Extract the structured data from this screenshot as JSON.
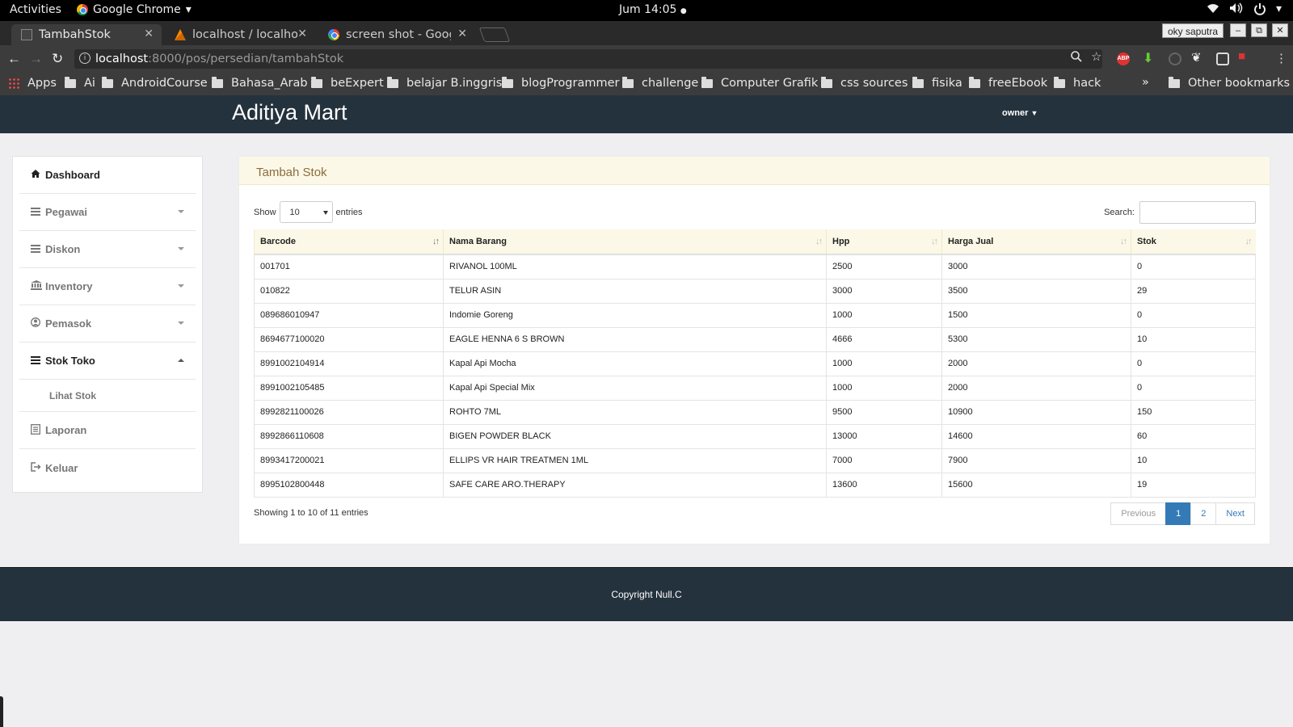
{
  "system_bar": {
    "activities": "Activities",
    "app_name": "Google Chrome",
    "clock": "Jum 14:05"
  },
  "browser": {
    "tabs": [
      {
        "title": "TambahStok",
        "favicon": "page-icon",
        "active": true
      },
      {
        "title": "localhost / localhos",
        "favicon": "phpmyadmin-icon",
        "active": false
      },
      {
        "title": "screen shot - Googl",
        "favicon": "google-icon",
        "active": false
      }
    ],
    "profile_name": "oky saputra",
    "url_host": "localhost",
    "url_rest": ":8000/pos/persedian/tambahStok",
    "bookmarks": [
      {
        "label": "Apps",
        "icon": "apps-grid-icon"
      },
      {
        "label": "Ai",
        "icon": "folder-icon"
      },
      {
        "label": "AndroidCourse",
        "icon": "folder-icon"
      },
      {
        "label": "Bahasa_Arab",
        "icon": "folder-icon"
      },
      {
        "label": "beExpert",
        "icon": "folder-icon"
      },
      {
        "label": "belajar B.inggris",
        "icon": "folder-icon"
      },
      {
        "label": "blogProgrammer",
        "icon": "folder-icon"
      },
      {
        "label": "challenge",
        "icon": "folder-icon"
      },
      {
        "label": "Computer Grafik",
        "icon": "folder-icon"
      },
      {
        "label": "css sources",
        "icon": "folder-icon"
      },
      {
        "label": "fisika",
        "icon": "folder-icon"
      },
      {
        "label": "freeEbook",
        "icon": "folder-icon"
      },
      {
        "label": "hack",
        "icon": "folder-icon"
      }
    ],
    "overflow": "»",
    "other_bookmarks": "Other bookmarks"
  },
  "header": {
    "brand": "Aditiya Mart",
    "user_menu": "owner"
  },
  "sidebar": {
    "items": [
      {
        "label": "Dashboard",
        "icon": "home-icon"
      },
      {
        "label": "Pegawai",
        "icon": "list-icon"
      },
      {
        "label": "Diskon",
        "icon": "list-icon"
      },
      {
        "label": "Inventory",
        "icon": "bank-icon"
      },
      {
        "label": "Pemasok",
        "icon": "user-circle-icon"
      },
      {
        "label": "Stok Toko",
        "icon": "list-icon"
      },
      {
        "label": "Lihat Stok",
        "icon": ""
      },
      {
        "label": "Laporan",
        "icon": "report-icon"
      },
      {
        "label": "Keluar",
        "icon": "sign-out-icon"
      }
    ]
  },
  "main": {
    "panel_title": "Tambah Stok",
    "show_label": "Show",
    "page_length": "10",
    "entries_label": "entries",
    "search_label": "Search:",
    "search_value": "",
    "columns": [
      "Barcode",
      "Nama Barang",
      "Hpp",
      "Harga Jual",
      "Stok"
    ],
    "rows": [
      [
        "001701",
        "RIVANOL 100ML",
        "2500",
        "3000",
        "0"
      ],
      [
        "010822",
        "TELUR ASIN",
        "3000",
        "3500",
        "29"
      ],
      [
        "089686010947",
        "Indomie Goreng",
        "1000",
        "1500",
        "0"
      ],
      [
        "8694677100020",
        "EAGLE HENNA 6 S BROWN",
        "4666",
        "5300",
        "10"
      ],
      [
        "8991002104914",
        "Kapal Api Mocha",
        "1000",
        "2000",
        "0"
      ],
      [
        "8991002105485",
        "Kapal Api Special Mix",
        "1000",
        "2000",
        "0"
      ],
      [
        "8992821100026",
        "ROHTO 7ML",
        "9500",
        "10900",
        "150"
      ],
      [
        "8992866110608",
        "BIGEN POWDER BLACK",
        "13000",
        "14600",
        "60"
      ],
      [
        "8993417200021",
        "ELLIPS VR HAIR TREATMEN 1ML",
        "7000",
        "7900",
        "10"
      ],
      [
        "8995102800448",
        "SAFE CARE ARO.THERAPY",
        "13600",
        "15600",
        "19"
      ]
    ],
    "info": "Showing 1 to 10 of 11 entries",
    "pagination": {
      "previous": "Previous",
      "pages": [
        "1",
        "2"
      ],
      "next": "Next",
      "current": "1"
    }
  },
  "footer": {
    "copyright": "Copyright Null.C"
  },
  "colors": {
    "header_bg": "#24323d",
    "panel_head_bg": "#fcf8e8",
    "accent": "#337ab7"
  }
}
